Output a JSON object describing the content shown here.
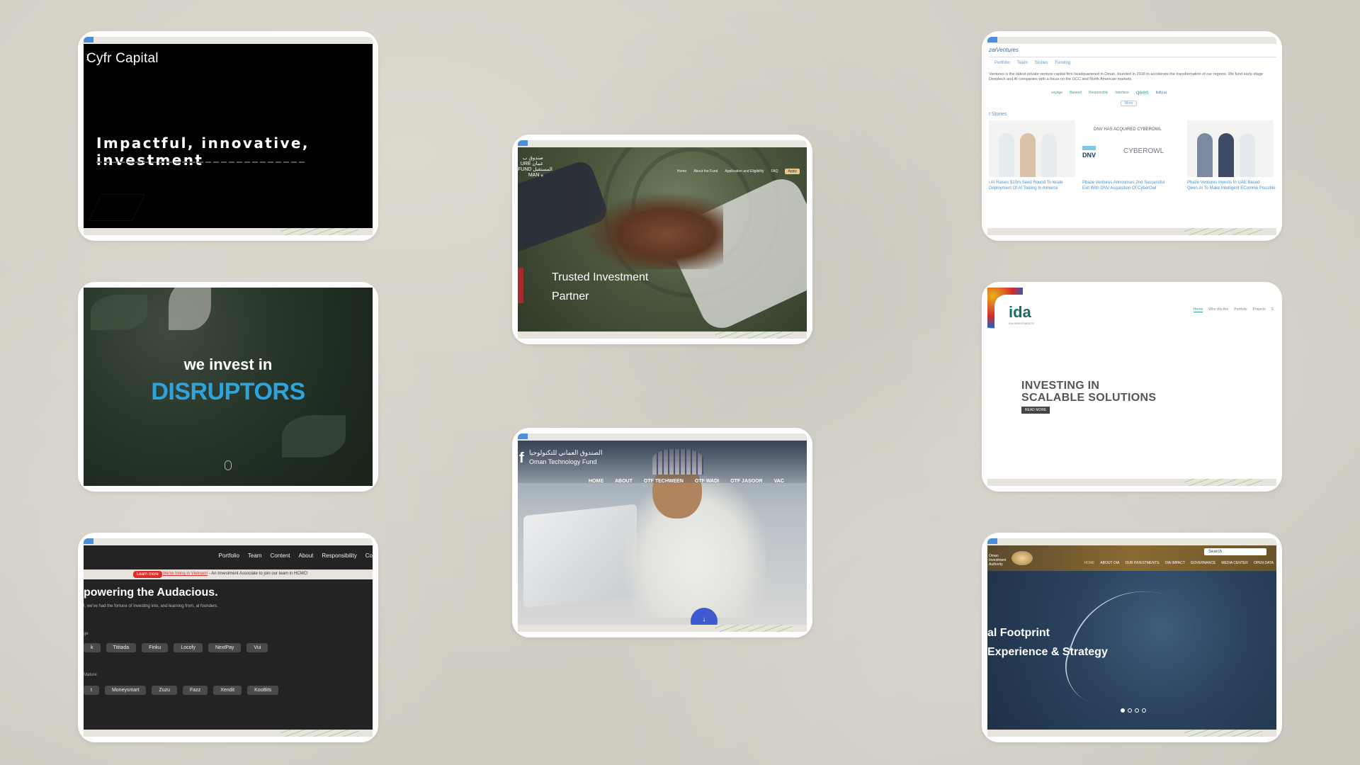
{
  "cards": {
    "cyfr": {
      "logo": "Cyfr Capital",
      "tagline": "Impactful, innovative, investment"
    },
    "disruptors": {
      "line1": "we invest in",
      "line2": "DISRUPTORS"
    },
    "audacious": {
      "nav": [
        "Portfolio",
        "Team",
        "Content",
        "About",
        "Responsibility",
        "Co"
      ],
      "learn_more": "Learn more",
      "banner_link": "We're hiring in Vietnam!",
      "banner_text": " - An Investment Associate to join our team in HCMC!",
      "headline": "powering the Audacious.",
      "para": "l, we've had the fortune of investing into, and learning from, al founders.",
      "stage1_label": "ge",
      "stage1_chips": [
        "k",
        "Tititada",
        "Finku",
        "Locofy",
        "NextPay",
        "Vui"
      ],
      "stage2_label": "Mature",
      "stage2_chips": [
        "t",
        "Moneysmart",
        "Zuzu",
        "Fazz",
        "Xendit",
        "KooBits"
      ]
    },
    "trusted": {
      "logo": "صندوق ب\nURE عمان\nFUND المستقبل\nMAN ه",
      "nav": [
        "Home",
        "About the Fund",
        "Application and Eligibility",
        "FAQ"
      ],
      "apply": "Apply",
      "title": "Trusted Investment Partner"
    },
    "otf": {
      "logo_letter": "f",
      "name_ar": "الصندوق العماني للتكنولوجيا",
      "name_en": "Oman Technology Fund",
      "nav": [
        "HOME",
        "ABOUT",
        "OTF TECHWEEN",
        "OTF WADI",
        "OTF JASOOR",
        "VAC"
      ],
      "scroll": "↓"
    },
    "ventures": {
      "logo": "zaiVentures",
      "nav": [
        "Portfolio",
        "Team",
        "Stories",
        "Funding"
      ],
      "intro": "Ventures is the oldest private venture capital firm headquartered in Oman, founded in 2018 to accelerate the transformation of our regions. We fund early-stage Deeptech and AI companies with a focus on the GCC and North American markets.",
      "logos": [
        "voyage",
        "Baseed",
        "Responsibly",
        "Interface",
        "qeen",
        "bully.ai"
      ],
      "more": "More",
      "stories_label": "t Stories",
      "dnv_heading": "DNV HAS ACQUIRED CYBEROWL",
      "dnv": "DNV",
      "cyberowl": "CYBEROWL",
      "captions": [
        "i AI Raises $10m Seed Round To lerate Deployment Of AI Tooling In mmerce",
        "Phaze Ventures Announces 2nd Successful Exit With DNV Acquisition Of CyberOwl",
        "Phaze Ventures Invests In UAE Based Qeen.AI To Make Intelligent EComme Possible"
      ]
    },
    "ida": {
      "logo": "ida",
      "logo_sub": "IDA INVESTMENTS",
      "nav": [
        "Home",
        "Who We Are",
        "Portfolio",
        "Projects",
        "S"
      ],
      "title_line1": "INVESTING IN",
      "title_line2": "SCALABLE SOLUTIONS",
      "button": "READ MORE"
    },
    "footprint": {
      "logo": "Oman Investment Authority",
      "search": "Search",
      "nav": [
        "HOME",
        "ABOUT OIA",
        "OUR INVESTMENTS",
        "OIA IMPACT",
        "GOVERNANCE",
        "MEDIA CENTER",
        "OPEN DATA"
      ],
      "line1": "al Footprint",
      "line2": "Experience & Strategy",
      "slide_count": 4,
      "active_slide": 1
    }
  }
}
